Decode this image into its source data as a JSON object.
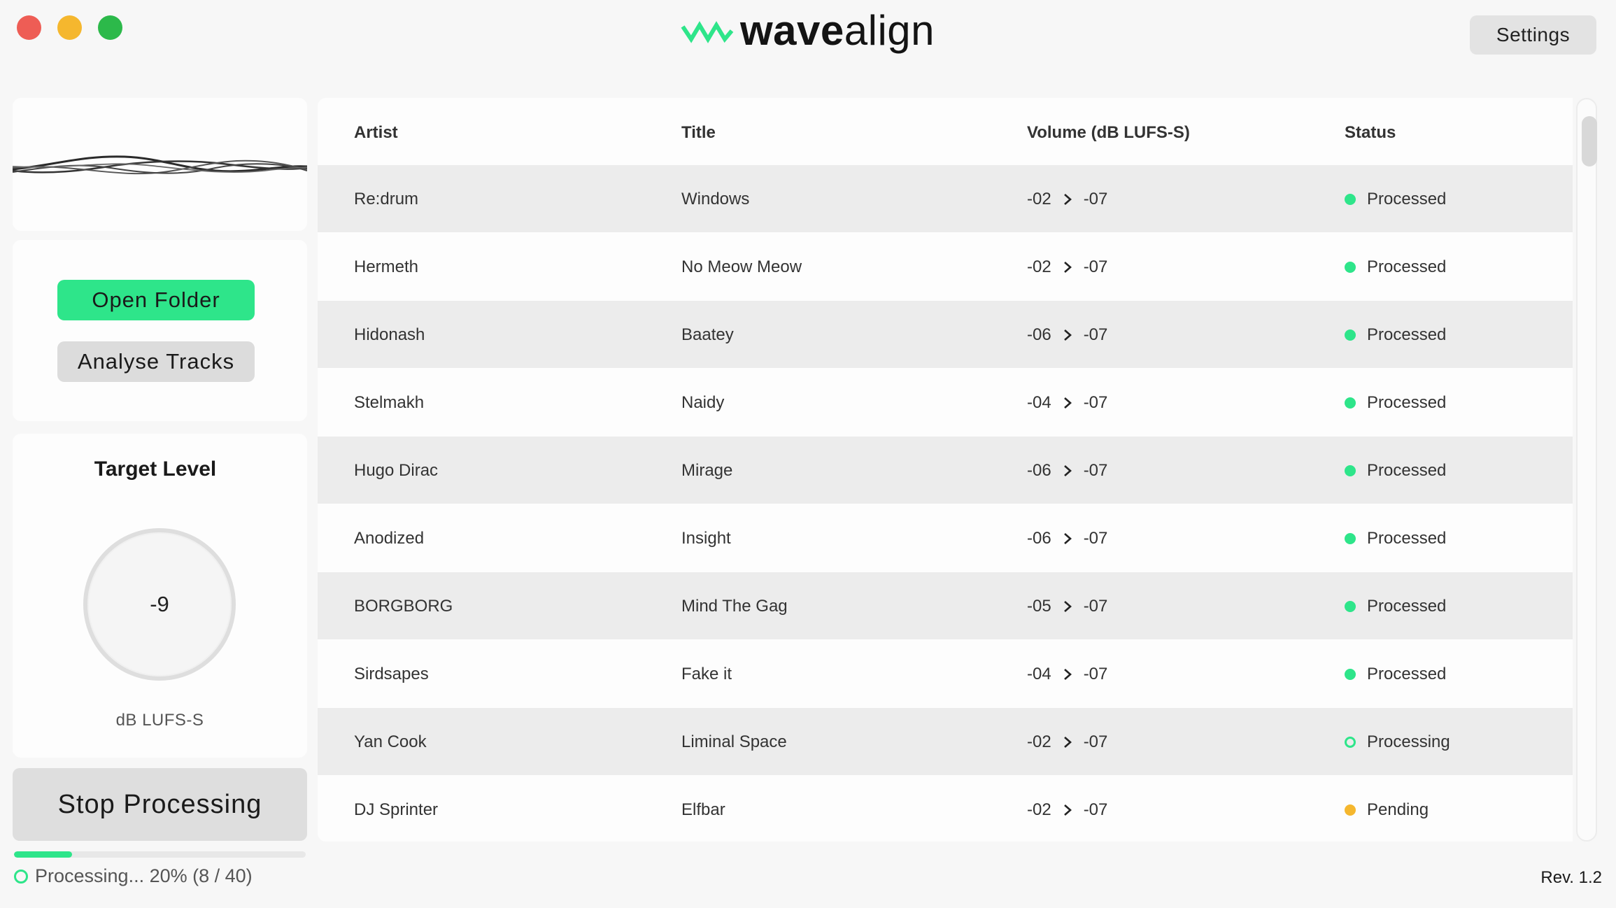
{
  "app": {
    "name_bold": "wave",
    "name_light": "align",
    "settings_label": "Settings",
    "revision": "Rev. 1.2",
    "accent_color": "#2ee58a"
  },
  "actions": {
    "open_folder": "Open Folder",
    "analyse_tracks": "Analyse Tracks",
    "stop_processing": "Stop Processing"
  },
  "target": {
    "title": "Target Level",
    "value": "-9",
    "unit": "dB LUFS-S"
  },
  "progress": {
    "text": "Processing... 20% (8 / 40)",
    "fraction": 0.2
  },
  "table": {
    "headers": {
      "artist": "Artist",
      "title": "Title",
      "volume": "Volume (dB LUFS-S)",
      "status": "Status"
    },
    "rows": [
      {
        "artist": "Re:drum",
        "title": "Windows",
        "from": "-02",
        "to": "-07",
        "status": "Processed",
        "state": "processed"
      },
      {
        "artist": "Hermeth",
        "title": "No Meow Meow",
        "from": "-02",
        "to": "-07",
        "status": "Processed",
        "state": "processed"
      },
      {
        "artist": "Hidonash",
        "title": "Baatey",
        "from": "-06",
        "to": "-07",
        "status": "Processed",
        "state": "processed"
      },
      {
        "artist": "Stelmakh",
        "title": "Naidy",
        "from": "-04",
        "to": "-07",
        "status": "Processed",
        "state": "processed"
      },
      {
        "artist": "Hugo Dirac",
        "title": "Mirage",
        "from": "-06",
        "to": "-07",
        "status": "Processed",
        "state": "processed"
      },
      {
        "artist": "Anodized",
        "title": "Insight",
        "from": "-06",
        "to": "-07",
        "status": "Processed",
        "state": "processed"
      },
      {
        "artist": "BORGBORG",
        "title": "Mind The Gag",
        "from": "-05",
        "to": "-07",
        "status": "Processed",
        "state": "processed"
      },
      {
        "artist": "Sirdsapes",
        "title": "Fake it",
        "from": "-04",
        "to": "-07",
        "status": "Processed",
        "state": "processed"
      },
      {
        "artist": "Yan Cook",
        "title": "Liminal Space",
        "from": "-02",
        "to": "-07",
        "status": "Processing",
        "state": "processing"
      },
      {
        "artist": "DJ Sprinter",
        "title": "Elfbar",
        "from": "-02",
        "to": "-07",
        "status": "Pending",
        "state": "pending"
      }
    ]
  }
}
